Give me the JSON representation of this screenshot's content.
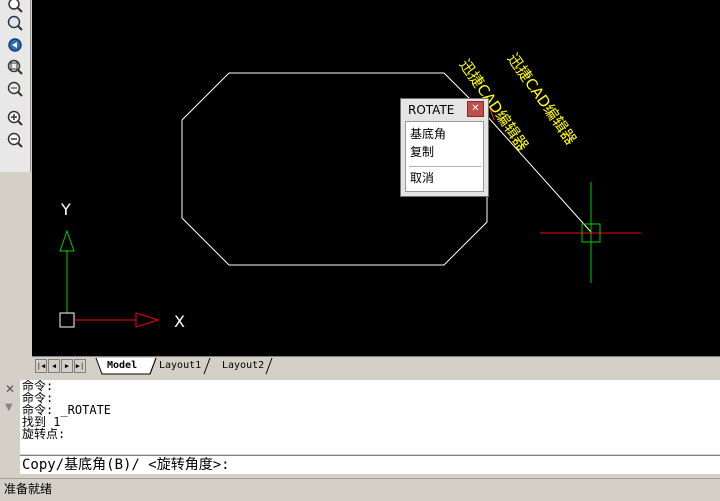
{
  "canvas": {
    "watermark": "迅捷CAD编辑器",
    "axes": {
      "x_label": "X",
      "y_label": "Y"
    },
    "colors": {
      "background": "#000000",
      "geometry": "#ffffff",
      "watermark": "#ffff00",
      "x_axis": "#ff0000",
      "y_axis": "#00cc00"
    }
  },
  "toolbar": {
    "icons": [
      "zoom-realtime-icon",
      "zoom-window-icon",
      "zoom-previous-icon",
      "zoom-extents-icon",
      "zoom-all-icon",
      "zoom-in-icon",
      "zoom-out-icon"
    ]
  },
  "context_menu": {
    "title": "ROTATE",
    "items": [
      "基底角",
      "复制",
      "取消"
    ]
  },
  "tabs": {
    "nav": [
      "|◀",
      "◀",
      "▶",
      "▶|"
    ],
    "items": [
      "Model",
      "Layout1",
      "Layout2"
    ],
    "active": "Model"
  },
  "command": {
    "history": [
      "命令:",
      "命令:",
      "命令: _ROTATE",
      "找到 1",
      "旋转点:"
    ],
    "prompt": "Copy/基底角(B)/ <旋转角度>:"
  },
  "status": {
    "text": "准备就绪"
  }
}
